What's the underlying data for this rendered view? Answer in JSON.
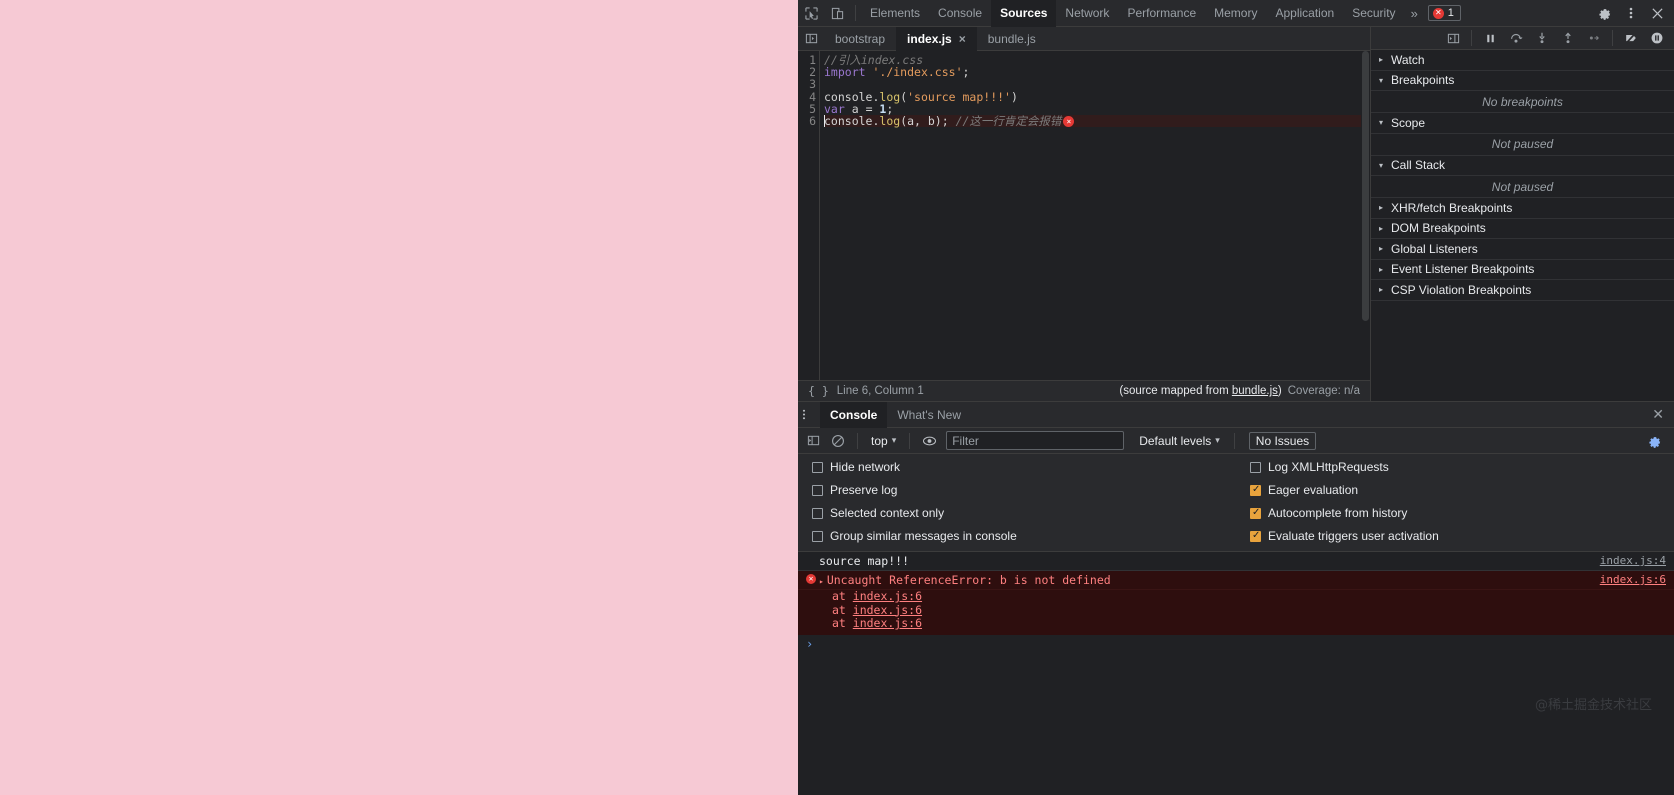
{
  "window": {
    "page_background": "#f6c9d4",
    "devtools_background": "#202124",
    "accent": "#e8a33d",
    "error_color": "#e53935"
  },
  "main_tabs": {
    "items": [
      {
        "label": "Elements",
        "active": false
      },
      {
        "label": "Console",
        "active": false
      },
      {
        "label": "Sources",
        "active": true
      },
      {
        "label": "Network",
        "active": false
      },
      {
        "label": "Performance",
        "active": false
      },
      {
        "label": "Memory",
        "active": false
      },
      {
        "label": "Application",
        "active": false
      },
      {
        "label": "Security",
        "active": false
      }
    ],
    "more_label": "»",
    "error_count": "1",
    "settings_icon": "gear-icon",
    "kebab_icon": "more-options-icon",
    "close_icon": "close-icon",
    "inspect_icon": "inspect-element-icon",
    "device_icon": "device-toolbar-icon"
  },
  "file_tabs": {
    "navigator_toggle": "show-navigator-icon",
    "items": [
      {
        "label": "bootstrap",
        "active": false,
        "closable": false
      },
      {
        "label": "index.js",
        "active": true,
        "closable": true
      },
      {
        "label": "bundle.js",
        "active": false,
        "closable": false
      }
    ],
    "close_glyph": "×"
  },
  "debug_toolbar": {
    "icons": [
      {
        "name": "show-debugger-sidebar-icon",
        "glyph": "▷|"
      },
      {
        "name": "pause-resume-icon",
        "glyph": "‖"
      },
      {
        "name": "step-over-icon",
        "glyph": "↷"
      },
      {
        "name": "step-into-icon",
        "glyph": "↓"
      },
      {
        "name": "step-out-icon",
        "glyph": "↑"
      },
      {
        "name": "step-icon",
        "glyph": "→"
      },
      {
        "name": "deactivate-breakpoints-icon",
        "glyph": "⊘"
      },
      {
        "name": "pause-on-exceptions-icon",
        "glyph": "⏸"
      }
    ]
  },
  "editor": {
    "lines": [
      {
        "num": "1",
        "tokens": [
          {
            "t": "//引入index.css",
            "c": "cm"
          }
        ]
      },
      {
        "num": "2",
        "tokens": [
          {
            "t": "import",
            "c": "kw"
          },
          {
            "t": " ",
            "c": "id"
          },
          {
            "t": "'./index.css'",
            "c": "str"
          },
          {
            "t": ";",
            "c": "id"
          }
        ]
      },
      {
        "num": "3",
        "tokens": []
      },
      {
        "num": "4",
        "tokens": [
          {
            "t": "console",
            "c": "id"
          },
          {
            "t": ".",
            "c": "id"
          },
          {
            "t": "log",
            "c": "fn"
          },
          {
            "t": "(",
            "c": "id"
          },
          {
            "t": "'source map!!!'",
            "c": "str"
          },
          {
            "t": ")",
            "c": "id"
          }
        ]
      },
      {
        "num": "5",
        "tokens": [
          {
            "t": "var",
            "c": "kw"
          },
          {
            "t": " a ",
            "c": "id"
          },
          {
            "t": "= ",
            "c": "id"
          },
          {
            "t": "1",
            "c": "num"
          },
          {
            "t": ";",
            "c": "id"
          }
        ]
      },
      {
        "num": "6",
        "tokens": [
          {
            "t": "console",
            "c": "id"
          },
          {
            "t": ".",
            "c": "id"
          },
          {
            "t": "log",
            "c": "fn"
          },
          {
            "t": "(a, b); ",
            "c": "id"
          },
          {
            "t": "//这一行肯定会报错",
            "c": "cm"
          }
        ],
        "error": true,
        "error_marker": "×"
      }
    ]
  },
  "status_bar": {
    "format_icon": "pretty-print-icon",
    "position": "Line 6, Column 1",
    "source_mapped_prefix": "(source mapped from ",
    "source_mapped_link": "bundle.js",
    "source_mapped_suffix": ")",
    "coverage": "Coverage: n/a"
  },
  "debugger_sidebar": {
    "sections": [
      {
        "label": "Watch",
        "expanded": false,
        "body": null
      },
      {
        "label": "Breakpoints",
        "expanded": true,
        "body": "No breakpoints"
      },
      {
        "label": "Scope",
        "expanded": true,
        "body": "Not paused"
      },
      {
        "label": "Call Stack",
        "expanded": true,
        "body": "Not paused"
      },
      {
        "label": "XHR/fetch Breakpoints",
        "expanded": false,
        "body": null
      },
      {
        "label": "DOM Breakpoints",
        "expanded": false,
        "body": null
      },
      {
        "label": "Global Listeners",
        "expanded": false,
        "body": null
      },
      {
        "label": "Event Listener Breakpoints",
        "expanded": false,
        "body": null
      },
      {
        "label": "CSP Violation Breakpoints",
        "expanded": false,
        "body": null
      }
    ],
    "expanded_glyph": "▾",
    "collapsed_glyph": "▸"
  },
  "drawer": {
    "kebab_icon": "more-tools-icon",
    "tabs": [
      {
        "label": "Console",
        "active": true
      },
      {
        "label": "What's New",
        "active": false
      }
    ],
    "close_icon": "close-drawer-icon",
    "close_glyph": "✕"
  },
  "console_toolbar": {
    "sidebar_icon": "console-sidebar-icon",
    "clear_icon": "clear-console-icon",
    "context": "top",
    "context_chevron": "▾",
    "eye_icon": "live-expression-icon",
    "filter_placeholder": "Filter",
    "filter_value": "",
    "levels_label": "Default levels",
    "levels_chevron": "▾",
    "issues_label": "No Issues",
    "settings_icon": "console-settings-gear-icon"
  },
  "console_settings": {
    "left": [
      {
        "label": "Hide network",
        "checked": false
      },
      {
        "label": "Preserve log",
        "checked": false
      },
      {
        "label": "Selected context only",
        "checked": false
      },
      {
        "label": "Group similar messages in console",
        "checked": false
      }
    ],
    "right": [
      {
        "label": "Log XMLHttpRequests",
        "checked": false
      },
      {
        "label": "Eager evaluation",
        "checked": true
      },
      {
        "label": "Autocomplete from history",
        "checked": true
      },
      {
        "label": "Evaluate triggers user activation",
        "checked": true
      }
    ]
  },
  "console_messages": [
    {
      "type": "log",
      "text": "source map!!!",
      "source": "index.js:4",
      "icon": null,
      "expander": null,
      "stack": []
    },
    {
      "type": "error",
      "text": "Uncaught ReferenceError: b is not defined",
      "source": "index.js:6",
      "icon": "error-circle-icon",
      "expander": "▸",
      "stack": [
        {
          "prefix": "at ",
          "link": "index.js:6"
        },
        {
          "prefix": "at ",
          "link": "index.js:6"
        },
        {
          "prefix": "at ",
          "link": "index.js:6"
        }
      ]
    }
  ],
  "console_prompt": {
    "glyph": "›",
    "value": ""
  },
  "watermark": {
    "text": "@稀土掘金技术社区"
  }
}
